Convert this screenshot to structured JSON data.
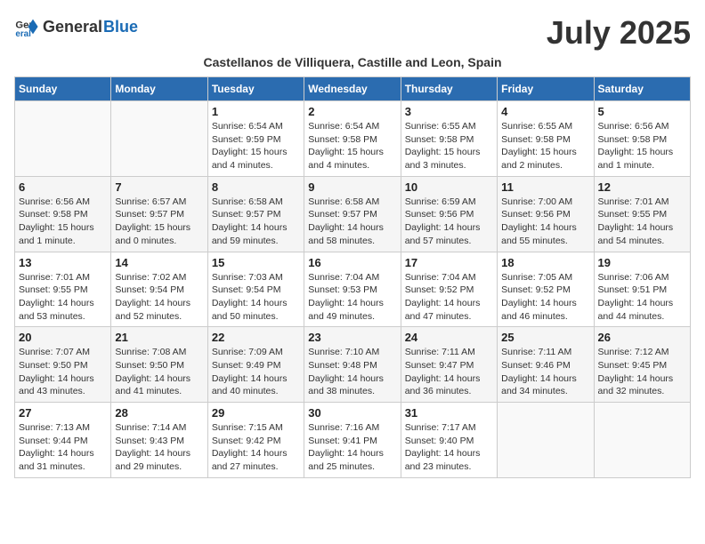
{
  "header": {
    "logo_general": "General",
    "logo_blue": "Blue",
    "month_title": "July 2025",
    "subtitle": "Castellanos de Villiquera, Castille and Leon, Spain"
  },
  "days_of_week": [
    "Sunday",
    "Monday",
    "Tuesday",
    "Wednesday",
    "Thursday",
    "Friday",
    "Saturday"
  ],
  "weeks": [
    [
      {
        "day": "",
        "info": ""
      },
      {
        "day": "",
        "info": ""
      },
      {
        "day": "1",
        "info": "Sunrise: 6:54 AM\nSunset: 9:59 PM\nDaylight: 15 hours and 4 minutes."
      },
      {
        "day": "2",
        "info": "Sunrise: 6:54 AM\nSunset: 9:58 PM\nDaylight: 15 hours and 4 minutes."
      },
      {
        "day": "3",
        "info": "Sunrise: 6:55 AM\nSunset: 9:58 PM\nDaylight: 15 hours and 3 minutes."
      },
      {
        "day": "4",
        "info": "Sunrise: 6:55 AM\nSunset: 9:58 PM\nDaylight: 15 hours and 2 minutes."
      },
      {
        "day": "5",
        "info": "Sunrise: 6:56 AM\nSunset: 9:58 PM\nDaylight: 15 hours and 1 minute."
      }
    ],
    [
      {
        "day": "6",
        "info": "Sunrise: 6:56 AM\nSunset: 9:58 PM\nDaylight: 15 hours and 1 minute."
      },
      {
        "day": "7",
        "info": "Sunrise: 6:57 AM\nSunset: 9:57 PM\nDaylight: 15 hours and 0 minutes."
      },
      {
        "day": "8",
        "info": "Sunrise: 6:58 AM\nSunset: 9:57 PM\nDaylight: 14 hours and 59 minutes."
      },
      {
        "day": "9",
        "info": "Sunrise: 6:58 AM\nSunset: 9:57 PM\nDaylight: 14 hours and 58 minutes."
      },
      {
        "day": "10",
        "info": "Sunrise: 6:59 AM\nSunset: 9:56 PM\nDaylight: 14 hours and 57 minutes."
      },
      {
        "day": "11",
        "info": "Sunrise: 7:00 AM\nSunset: 9:56 PM\nDaylight: 14 hours and 55 minutes."
      },
      {
        "day": "12",
        "info": "Sunrise: 7:01 AM\nSunset: 9:55 PM\nDaylight: 14 hours and 54 minutes."
      }
    ],
    [
      {
        "day": "13",
        "info": "Sunrise: 7:01 AM\nSunset: 9:55 PM\nDaylight: 14 hours and 53 minutes."
      },
      {
        "day": "14",
        "info": "Sunrise: 7:02 AM\nSunset: 9:54 PM\nDaylight: 14 hours and 52 minutes."
      },
      {
        "day": "15",
        "info": "Sunrise: 7:03 AM\nSunset: 9:54 PM\nDaylight: 14 hours and 50 minutes."
      },
      {
        "day": "16",
        "info": "Sunrise: 7:04 AM\nSunset: 9:53 PM\nDaylight: 14 hours and 49 minutes."
      },
      {
        "day": "17",
        "info": "Sunrise: 7:04 AM\nSunset: 9:52 PM\nDaylight: 14 hours and 47 minutes."
      },
      {
        "day": "18",
        "info": "Sunrise: 7:05 AM\nSunset: 9:52 PM\nDaylight: 14 hours and 46 minutes."
      },
      {
        "day": "19",
        "info": "Sunrise: 7:06 AM\nSunset: 9:51 PM\nDaylight: 14 hours and 44 minutes."
      }
    ],
    [
      {
        "day": "20",
        "info": "Sunrise: 7:07 AM\nSunset: 9:50 PM\nDaylight: 14 hours and 43 minutes."
      },
      {
        "day": "21",
        "info": "Sunrise: 7:08 AM\nSunset: 9:50 PM\nDaylight: 14 hours and 41 minutes."
      },
      {
        "day": "22",
        "info": "Sunrise: 7:09 AM\nSunset: 9:49 PM\nDaylight: 14 hours and 40 minutes."
      },
      {
        "day": "23",
        "info": "Sunrise: 7:10 AM\nSunset: 9:48 PM\nDaylight: 14 hours and 38 minutes."
      },
      {
        "day": "24",
        "info": "Sunrise: 7:11 AM\nSunset: 9:47 PM\nDaylight: 14 hours and 36 minutes."
      },
      {
        "day": "25",
        "info": "Sunrise: 7:11 AM\nSunset: 9:46 PM\nDaylight: 14 hours and 34 minutes."
      },
      {
        "day": "26",
        "info": "Sunrise: 7:12 AM\nSunset: 9:45 PM\nDaylight: 14 hours and 32 minutes."
      }
    ],
    [
      {
        "day": "27",
        "info": "Sunrise: 7:13 AM\nSunset: 9:44 PM\nDaylight: 14 hours and 31 minutes."
      },
      {
        "day": "28",
        "info": "Sunrise: 7:14 AM\nSunset: 9:43 PM\nDaylight: 14 hours and 29 minutes."
      },
      {
        "day": "29",
        "info": "Sunrise: 7:15 AM\nSunset: 9:42 PM\nDaylight: 14 hours and 27 minutes."
      },
      {
        "day": "30",
        "info": "Sunrise: 7:16 AM\nSunset: 9:41 PM\nDaylight: 14 hours and 25 minutes."
      },
      {
        "day": "31",
        "info": "Sunrise: 7:17 AM\nSunset: 9:40 PM\nDaylight: 14 hours and 23 minutes."
      },
      {
        "day": "",
        "info": ""
      },
      {
        "day": "",
        "info": ""
      }
    ]
  ]
}
